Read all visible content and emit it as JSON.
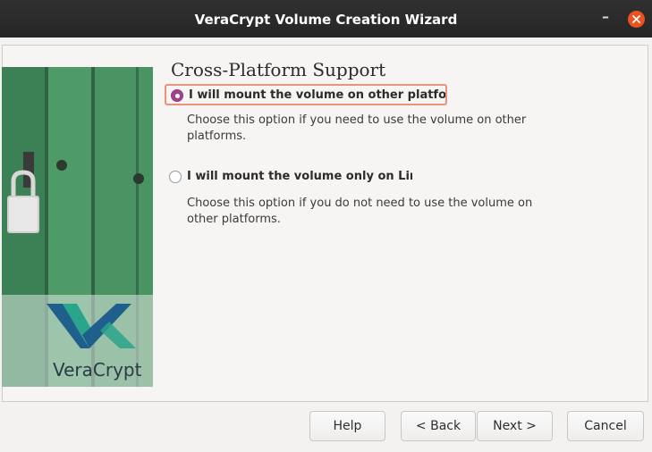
{
  "window": {
    "title": "VeraCrypt Volume Creation Wizard",
    "minimize_glyph": "–",
    "close_icon": "close-icon"
  },
  "wizard": {
    "heading": "Cross-Platform Support",
    "branding": "VeraCrypt",
    "options": [
      {
        "label": "I will mount the volume on other platforms",
        "description": "Choose this option if you need to use the volume on other platforms.",
        "selected": true
      },
      {
        "label": "I will mount the volume only on Linux",
        "description": "Choose this option if you do not need to use the volume on other platforms.",
        "selected": false
      }
    ]
  },
  "buttons": {
    "help": "Help",
    "back": "< Back",
    "next": "Next >",
    "cancel": "Cancel"
  },
  "colors": {
    "titlebar": "#2b2b2b",
    "close_button": "#e95420",
    "radio_selected": "#a3418f",
    "focus_ring": "#e8947a",
    "door_green": "#3f8f5c",
    "logo_blue": "#1f5f8b",
    "logo_teal": "#2aa58c"
  }
}
